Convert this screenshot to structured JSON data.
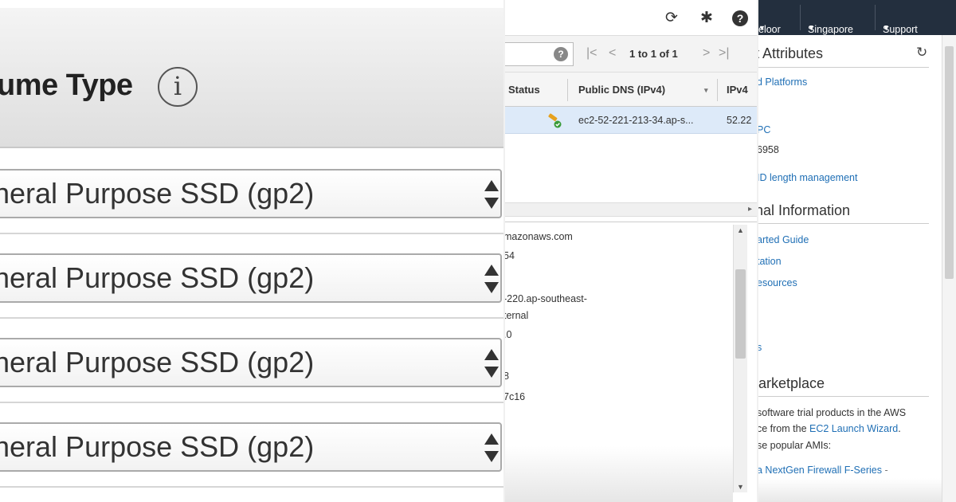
{
  "left": {
    "title": "ume Type",
    "info_icon": "info-icon",
    "selects": [
      {
        "value": "neral Purpose SSD (gp2)"
      },
      {
        "value": "neral Purpose SSD (gp2)"
      },
      {
        "value": "neral Purpose SSD (gp2)"
      },
      {
        "value": "neral Purpose SSD (gp2)"
      }
    ]
  },
  "middle": {
    "toolbar_icons": [
      "refresh-icon",
      "gear-icon",
      "help-icon"
    ],
    "help_glyph": "?",
    "filter_help_glyph": "?",
    "pager": {
      "first": "|<",
      "prev": "<",
      "text": "1 to 1 of 1",
      "next": ">",
      "last": ">|"
    },
    "columns": [
      "Status",
      "Public DNS (IPv4)",
      "IPv4"
    ],
    "row": {
      "public_dns": "ec2-52-221-213-34.ap-s...",
      "ipv4": "52.22"
    },
    "details": [
      "mazonaws.com",
      "54",
      "-220.ap-southeast-",
      "ternal",
      ".0",
      "8",
      "7c16"
    ]
  },
  "right": {
    "nav": {
      "account": "eloor",
      "region": "Singapore",
      "support": "Support"
    },
    "attributes": {
      "title": "t Attributes",
      "lines": [
        {
          "text": "d Platforms",
          "link": true
        },
        {
          "text": "PC",
          "link": true
        },
        {
          "text": "6958",
          "link": false
        },
        {
          "text": "ID length management",
          "link": true
        }
      ]
    },
    "additional": {
      "title": "nal Information",
      "links": [
        "arted Guide",
        "tation",
        "esources",
        "s"
      ]
    },
    "marketplace": {
      "title": "larketplace",
      "line1": "software trial products in the AWS",
      "line2_prefix": "ce from the",
      "line2_link": "EC2 Launch Wizard",
      "line2_suffix": ".",
      "line3": "se popular AMIs:",
      "product_link": "a NextGen Firewall F-Series",
      "product_suffix": "-"
    }
  },
  "colors": {
    "aws_nav": "#232f3e",
    "link": "#1f6fb5",
    "selected_row": "#ddeaf9"
  }
}
